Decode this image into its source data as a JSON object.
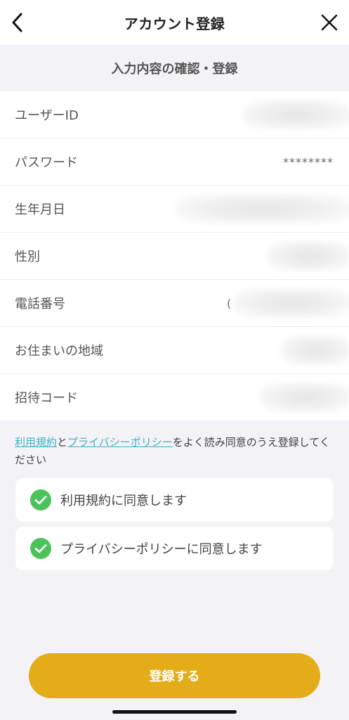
{
  "header": {
    "title": "アカウント登録",
    "back_icon": "chevron-left-icon",
    "close_icon": "close-icon"
  },
  "section_title": "入力内容の確認・登録",
  "fields": [
    {
      "label": "ユーザーID",
      "value": ""
    },
    {
      "label": "パスワード",
      "value": "********"
    },
    {
      "label": "生年月日",
      "value": ""
    },
    {
      "label": "性別",
      "value": ""
    },
    {
      "label": "電話番号",
      "value": "("
    },
    {
      "label": "お住まいの地域",
      "value": ""
    },
    {
      "label": "招待コード",
      "value": ""
    }
  ],
  "terms": {
    "link_terms": "利用規約",
    "and": "と",
    "link_privacy": "プライバシーポリシー",
    "rest": "をよく読み同意のうえ登録してください"
  },
  "agreements": [
    {
      "label": "利用規約に同意します",
      "checked": true
    },
    {
      "label": "プライバシーポリシーに同意します",
      "checked": true
    }
  ],
  "submit_label": "登録する",
  "colors": {
    "accent": "#e3ac18",
    "check": "#4cc35a",
    "link": "#3ab4c8",
    "background": "#f2f2f7"
  }
}
